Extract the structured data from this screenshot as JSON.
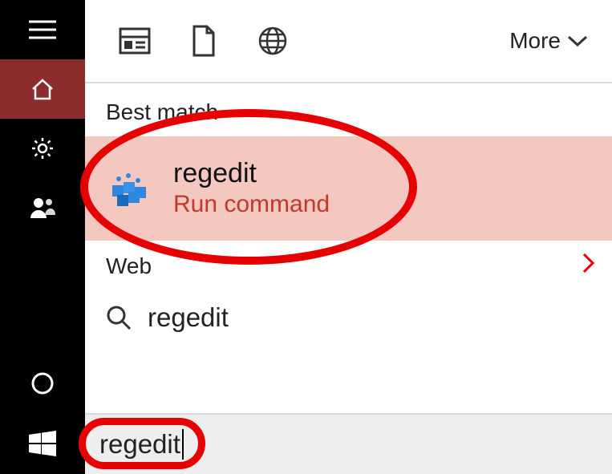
{
  "rail": {
    "items": [
      {
        "name": "hamburger"
      },
      {
        "name": "home"
      },
      {
        "name": "settings"
      },
      {
        "name": "people"
      },
      {
        "name": "cortana"
      },
      {
        "name": "start"
      }
    ]
  },
  "toolbar": {
    "more_label": "More"
  },
  "results": {
    "best_match_label": "Best match",
    "best_match": {
      "title": "regedit",
      "subtitle": "Run command",
      "icon": "regedit"
    },
    "web_label": "Web",
    "web_items": [
      {
        "title": "regedit"
      }
    ]
  },
  "search": {
    "value": "regedit"
  }
}
